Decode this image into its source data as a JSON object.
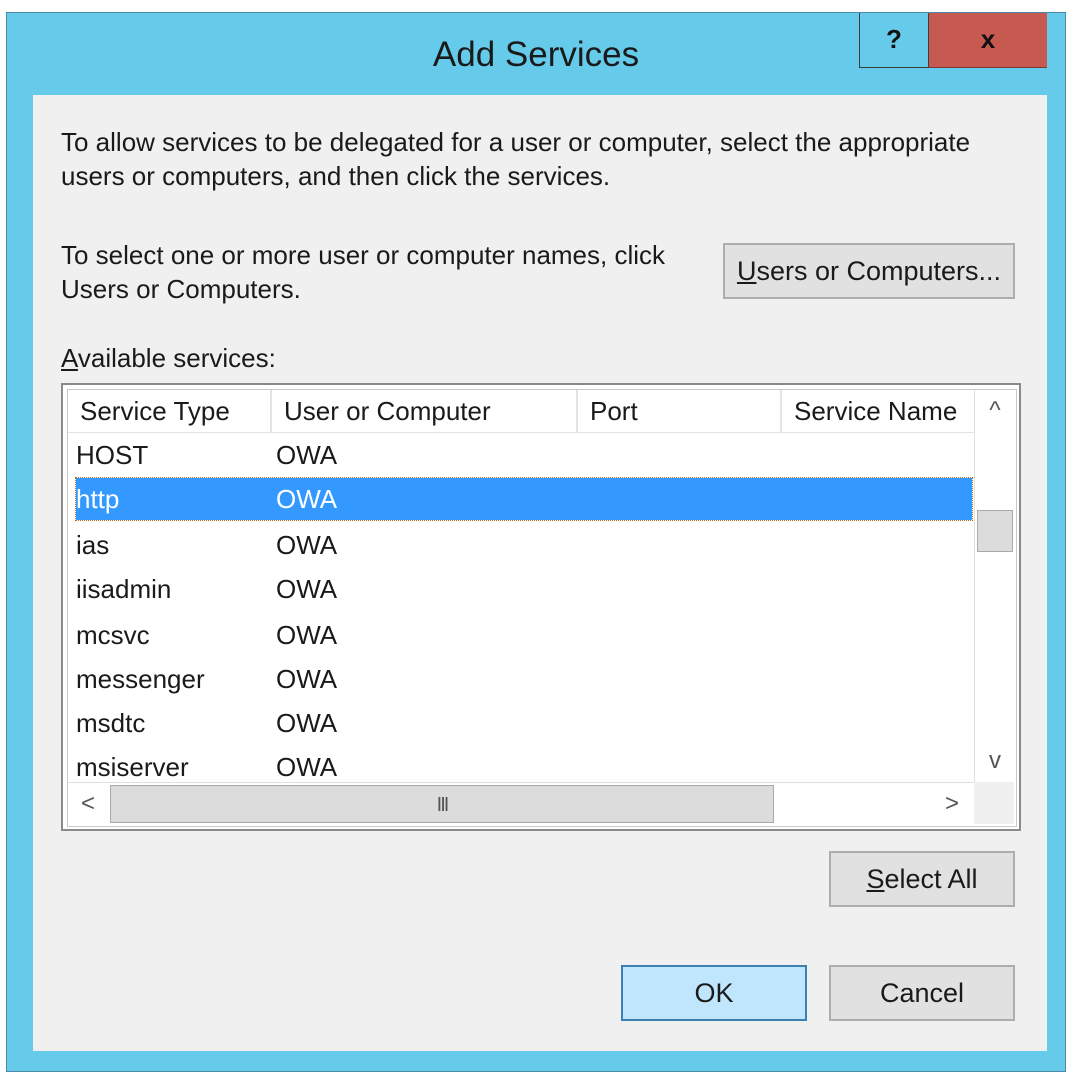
{
  "window": {
    "title": "Add Services",
    "help_label": "?",
    "close_label": "x"
  },
  "instructions": {
    "line1": "To allow services to be delegated for a user or computer, select the appropriate",
    "line2": "users or computers, and then click the services.",
    "select_line1": "To select one or more user or computer names, click",
    "select_line2": "Users or Computers."
  },
  "buttons": {
    "users_or_computers_mnemonic": "U",
    "users_or_computers_rest": "sers or Computers...",
    "select_all_mnemonic": "S",
    "select_all_rest": "elect All",
    "ok": "OK",
    "cancel": "Cancel"
  },
  "available_services": {
    "label_mnemonic": "A",
    "label_rest": "vailable services:",
    "columns": [
      "Service Type",
      "User or Computer",
      "Port",
      "Service Name"
    ],
    "rows": [
      {
        "service_type": "HOST",
        "user_or_computer": "OWA",
        "port": "",
        "service_name": "",
        "selected": false
      },
      {
        "service_type": "http",
        "user_or_computer": "OWA",
        "port": "",
        "service_name": "",
        "selected": true
      },
      {
        "service_type": "ias",
        "user_or_computer": "OWA",
        "port": "",
        "service_name": "",
        "selected": false
      },
      {
        "service_type": "iisadmin",
        "user_or_computer": "OWA",
        "port": "",
        "service_name": "",
        "selected": false
      },
      {
        "service_type": "mcsvc",
        "user_or_computer": "OWA",
        "port": "",
        "service_name": "",
        "selected": false
      },
      {
        "service_type": "messenger",
        "user_or_computer": "OWA",
        "port": "",
        "service_name": "",
        "selected": false
      },
      {
        "service_type": "msdtc",
        "user_or_computer": "OWA",
        "port": "",
        "service_name": "",
        "selected": false
      },
      {
        "service_type": "msiserver",
        "user_or_computer": "OWA",
        "port": "",
        "service_name": "",
        "selected": false
      }
    ],
    "scroll_glyphs": {
      "up": "^",
      "down": "v",
      "left": "<",
      "right": ">",
      "grip": "III"
    }
  },
  "colors": {
    "title_bar": "#66cbea",
    "close_button": "#c75a50",
    "selection": "#3399ff",
    "default_button": "#bfe6fd"
  }
}
